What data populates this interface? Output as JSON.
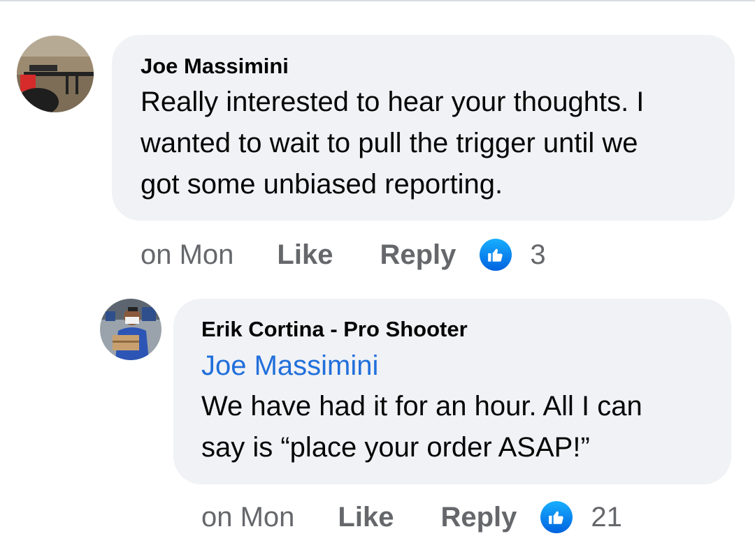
{
  "comments": [
    {
      "author": "Joe Massimini",
      "mention": "",
      "text_lines": [
        "Really interested to hear your thoughts.  I",
        "wanted to wait to pull the trigger until we",
        "got some unbiased reporting."
      ],
      "time": "on Mon",
      "like_label": "Like",
      "reply_label": "Reply",
      "reaction_icon": "like-icon",
      "reaction_count": "3"
    },
    {
      "author": "Erik Cortina - Pro Shooter",
      "mention": "Joe Massimini",
      "text_lines": [
        "We have had it for an hour.  All I can",
        "say is “place your order ASAP!”"
      ],
      "time": "on Mon",
      "like_label": "Like",
      "reply_label": "Reply",
      "reaction_icon": "like-icon",
      "reaction_count": "21"
    }
  ],
  "colors": {
    "bubble": "#f0f2f5",
    "mention": "#216fdb",
    "meta": "#65676b",
    "like_blue": "#1877f2"
  }
}
